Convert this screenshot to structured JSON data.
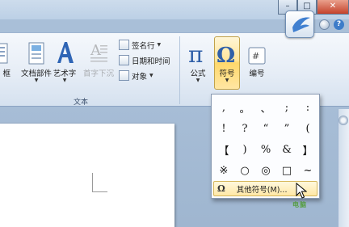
{
  "ribbon": {
    "buttons": {
      "kuang": "框",
      "doc_parts": "文档部件",
      "wordart": "艺术字",
      "dropcap": "首字下沉",
      "signature": "签名行",
      "datetime": "日期和时间",
      "object": "对象",
      "equation": "公式",
      "symbol": "符号",
      "number": "编号"
    },
    "group_text": "文本"
  },
  "symbol_menu": {
    "symbols": [
      ",",
      "。",
      "、",
      ";",
      ":",
      "!",
      "?",
      "“",
      "”",
      "(",
      "【",
      ")",
      "%",
      "&",
      "】",
      "※",
      "○",
      "◎",
      "□",
      "~"
    ],
    "more_label": "其他符号(M)..."
  },
  "icons": [
    "pi-icon",
    "omega-icon",
    "number-icon",
    "window-close-icon"
  ],
  "colors": {
    "highlight": "#ffe59a",
    "ribbon": "#e6edf6"
  }
}
